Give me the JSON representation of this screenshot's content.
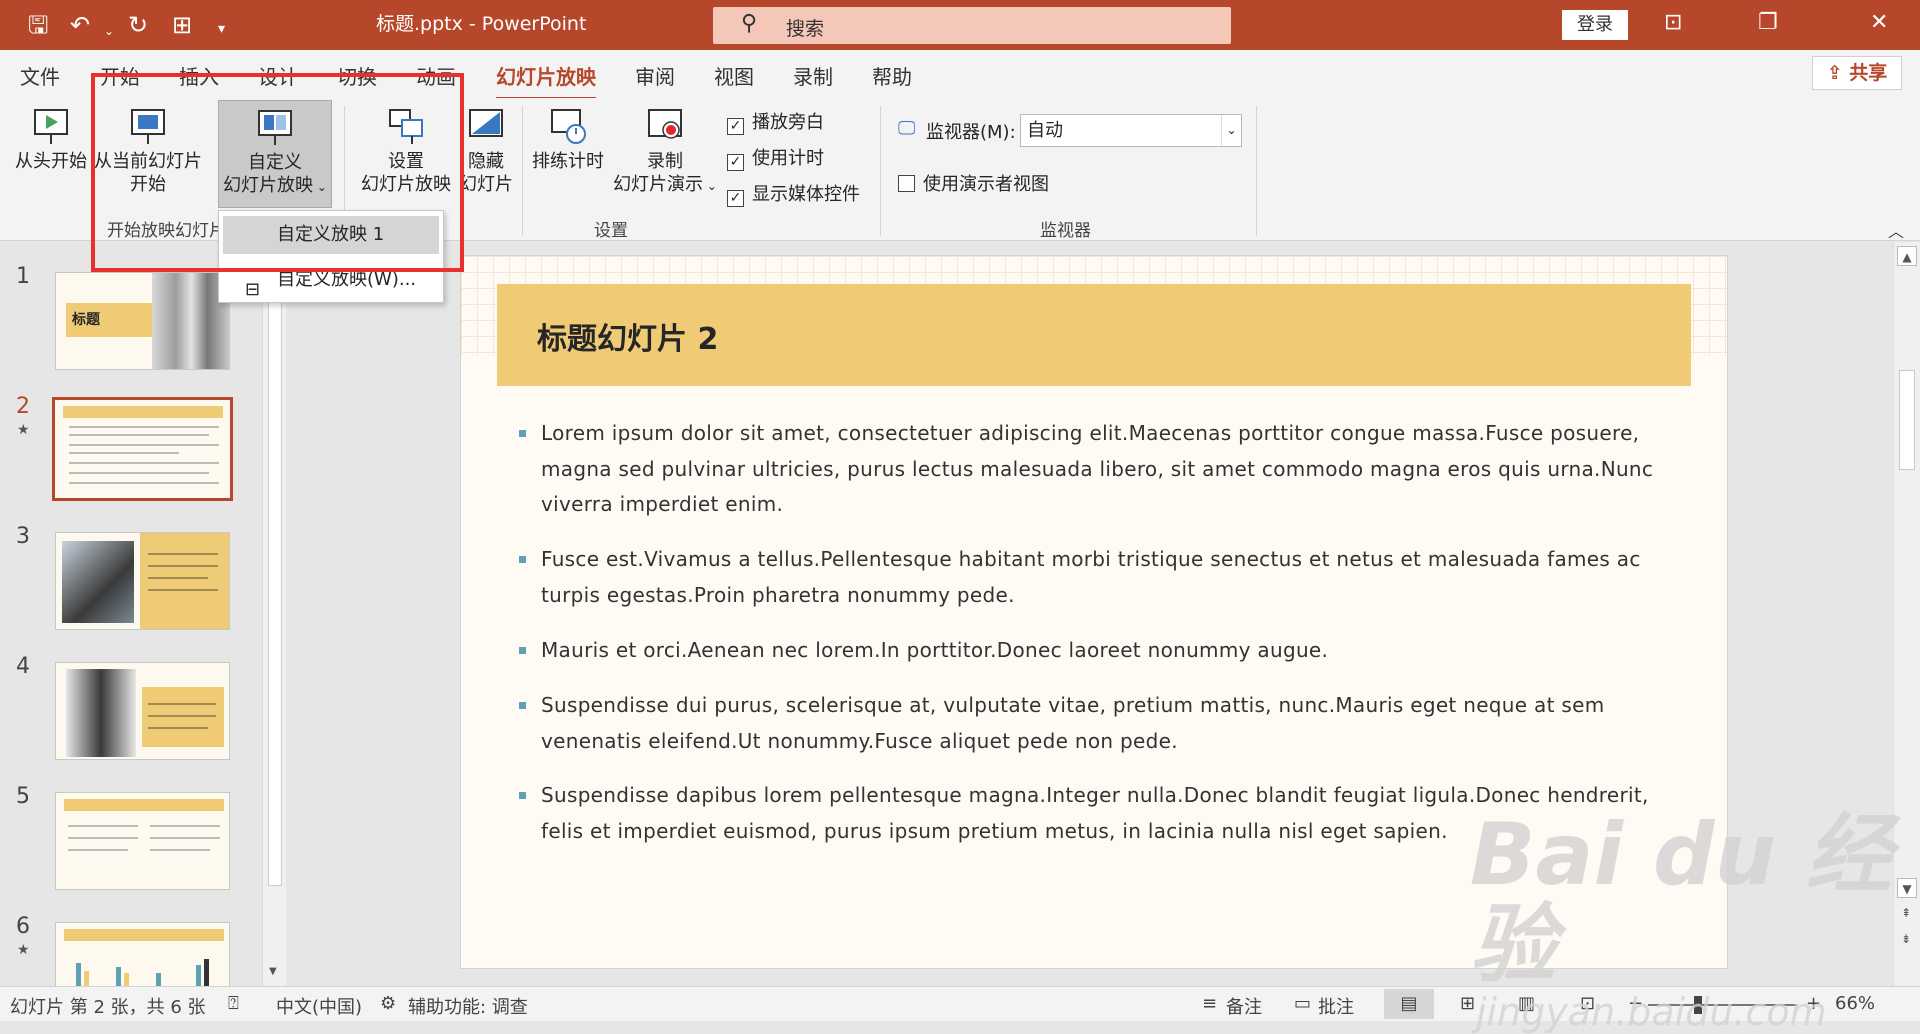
{
  "titlebar": {
    "doc_title": "标题.pptx  -  PowerPoint",
    "search_placeholder": "搜索",
    "login": "登录"
  },
  "tabs": [
    "文件",
    "开始",
    "插入",
    "设计",
    "切换",
    "动画",
    "幻灯片放映",
    "审阅",
    "视图",
    "录制",
    "帮助"
  ],
  "active_tab": "幻灯片放映",
  "share": "共享",
  "ribbon": {
    "from_beginning": "从头开始",
    "from_current_line1": "从当前幻灯片",
    "from_current_line2": "开始",
    "custom_line1": "自定义",
    "custom_line2": "幻灯片放映",
    "setup_line1": "设置",
    "setup_line2": "幻灯片放映",
    "hide_line1": "隐藏",
    "hide_line2": "幻灯片",
    "rehearse": "排练计时",
    "record_line1": "录制",
    "record_line2": "幻灯片演示",
    "play_narrations": "播放旁白",
    "use_timings": "使用计时",
    "show_media_controls": "显示媒体控件",
    "monitor_label": "监视器(M):",
    "monitor_value": "自动",
    "presenter_view": "使用演示者视图",
    "group_start": "开始放映幻灯片",
    "group_setup": "设置",
    "group_monitors": "监视器"
  },
  "dropdown": {
    "item1": "自定义放映 1",
    "item2": "自定义放映(W)..."
  },
  "thumbnails": [
    {
      "num": "1",
      "title": "标题"
    },
    {
      "num": "2"
    },
    {
      "num": "3"
    },
    {
      "num": "4"
    },
    {
      "num": "5"
    },
    {
      "num": "6"
    }
  ],
  "slide": {
    "title": "标题幻灯片 2",
    "bullets": [
      "Lorem ipsum dolor sit amet, consectetuer adipiscing elit.Maecenas porttitor congue massa.Fusce posuere, magna sed pulvinar ultricies, purus lectus malesuada libero, sit amet commodo magna eros quis urna.Nunc viverra imperdiet enim.",
      "Fusce est.Vivamus a tellus.Pellentesque habitant morbi tristique senectus et netus et malesuada fames ac turpis egestas.Proin pharetra nonummy pede.",
      "Mauris et orci.Aenean nec lorem.In porttitor.Donec laoreet nonummy augue.",
      "Suspendisse dui purus, scelerisque at, vulputate vitae, pretium mattis, nunc.Mauris eget neque at sem venenatis eleifend.Ut nonummy.Fusce aliquet pede non pede.",
      "Suspendisse dapibus lorem pellentesque magna.Integer nulla.Donec blandit feugiat ligula.Donec hendrerit, felis et imperdiet euismod, purus ipsum pretium metus, in lacinia nulla nisl eget sapien."
    ]
  },
  "watermark": {
    "line1": "Bai du 经验",
    "line2": "jingyan.baidu.com"
  },
  "status": {
    "slide_info": "幻灯片 第 2 张，共 6 张",
    "language": "中文(中国)",
    "accessibility": "辅助功能: 调查",
    "notes": "备注",
    "comments": "批注",
    "zoom": "66%"
  },
  "colors": {
    "accent": "#b7472a",
    "slide_header": "#f0cb76",
    "bullet": "#5fa2b6",
    "highlight_box": "#e8302f"
  }
}
